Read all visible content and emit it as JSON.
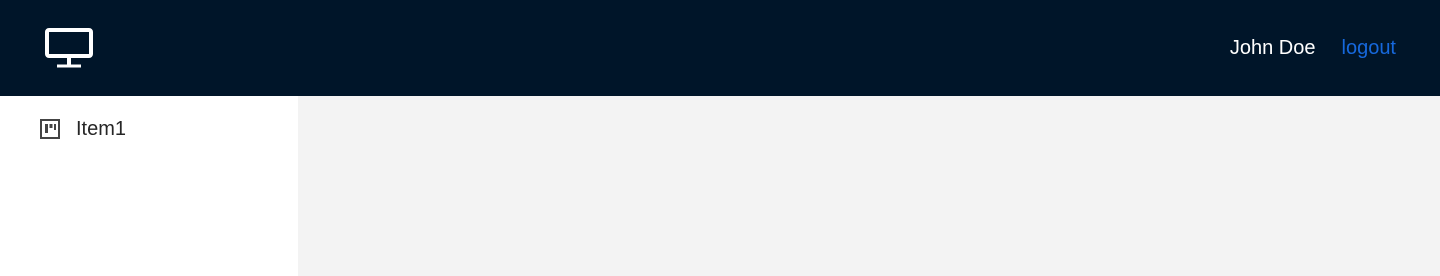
{
  "header": {
    "logo_icon": "desktop-icon",
    "user_name": "John Doe",
    "logout_label": "logout",
    "background_color": "#001529",
    "link_color": "#1668dc"
  },
  "sidebar": {
    "items": [
      {
        "label": "Item1",
        "icon": "project-board-icon"
      }
    ]
  },
  "content": {
    "background_color": "#f3f3f3"
  }
}
